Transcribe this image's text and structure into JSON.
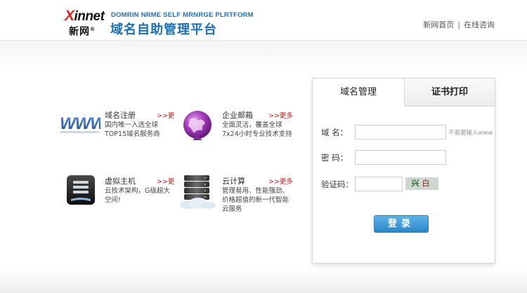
{
  "header": {
    "logo_brand": "innet",
    "logo_brand_x": "X",
    "logo_cn": "新网",
    "slogan_en": "DOMRIN NRME SELF MRNRGE PLRTFORM",
    "slogan_cn": "域名自助管理平台",
    "links": [
      "新网首页",
      "在线咨询"
    ],
    "link_separator": "|"
  },
  "services": [
    {
      "icon": "www-icon",
      "title": "域名注册",
      "more": ">>更",
      "desc": "国内唯一入选全球TOP15域名服务商"
    },
    {
      "icon": "mail-globe-icon",
      "title": "企业邮箱",
      "more": ">>更多",
      "desc": "全面灵活，覆盖全球7x24小时专业技术支持"
    },
    {
      "icon": "server-host-icon",
      "title": "虚拟主机",
      "more": ">>更",
      "desc": "云技术架构，G级超大空间!"
    },
    {
      "icon": "cloud-server-icon",
      "title": "云计算",
      "more": ">>更多",
      "desc": "管理易用、性能强劲、价格超值的新一代智能云服务"
    }
  ],
  "login": {
    "tabs": [
      "域名管理",
      "证书打印"
    ],
    "active_tab": "域名管理",
    "domain_label": "域  名：",
    "domain_value": "",
    "domain_hint": "不需要输入www",
    "password_label": "密  码：",
    "password_value": "",
    "captcha_label": "验证码：",
    "captcha_value": "",
    "captcha_text_1": "兴",
    "captcha_text_2": "白",
    "submit_label": "登录"
  },
  "colors": {
    "brand_blue": "#1a6fb5",
    "brand_red": "#d9281e",
    "more_red": "#c01a1a",
    "button_blue": "#2b86c8"
  }
}
